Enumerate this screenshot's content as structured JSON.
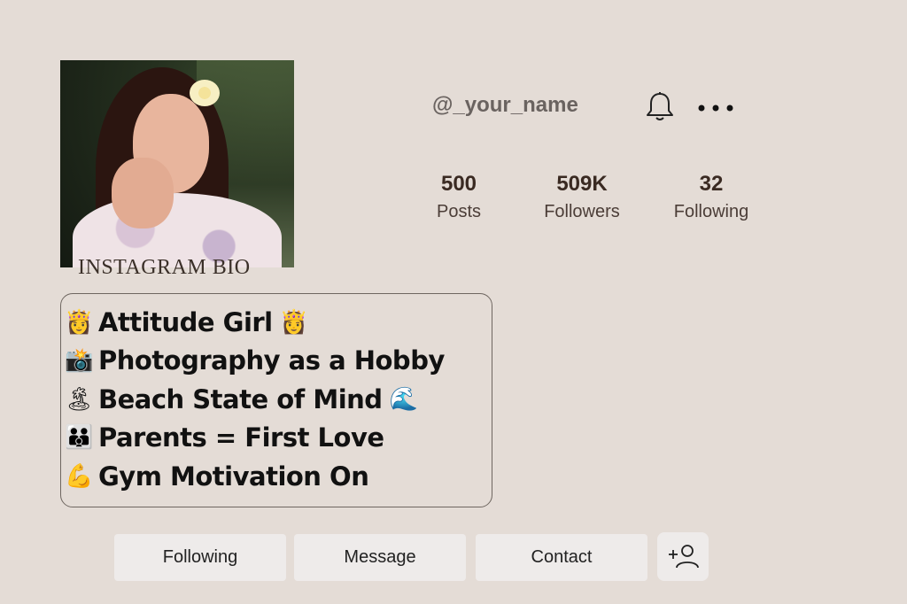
{
  "profile": {
    "username": "@_your_name",
    "photo_caption": "INSTAGRAM BIO"
  },
  "header": {
    "bell_icon": "bell-icon",
    "more_icon": "more-horizontal-icon"
  },
  "stats": [
    {
      "value": "500",
      "label": "Posts"
    },
    {
      "value": "509K",
      "label": "Followers"
    },
    {
      "value": "32",
      "label": "Following"
    }
  ],
  "bio": {
    "lines": [
      {
        "emoji": "👸",
        "text": "Attitude Girl",
        "emoji_end": "👸"
      },
      {
        "emoji": "📸",
        "text": "Photography as a Hobby",
        "emoji_end": ""
      },
      {
        "emoji": "🏝",
        "text": "Beach State of Mind",
        "emoji_end": "🌊"
      },
      {
        "emoji": "👪",
        "text": "Parents = First Love",
        "emoji_end": ""
      },
      {
        "emoji": "💪",
        "text": "Gym Motivation On",
        "emoji_end": ""
      }
    ]
  },
  "actions": {
    "following_label": "Following",
    "message_label": "Message",
    "contact_label": "Contact",
    "add_user_icon": "add-user-icon"
  },
  "colors": {
    "background": "#e4dcd6",
    "button_bg": "#eeebea",
    "text_dark": "#111111"
  }
}
